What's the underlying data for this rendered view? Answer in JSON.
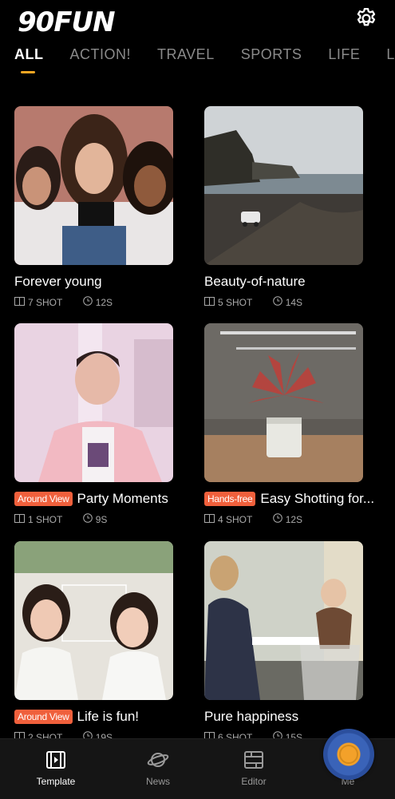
{
  "header": {
    "logo_text": "90FUN",
    "settings_icon": "gear-icon"
  },
  "tabs": [
    {
      "label": "ALL",
      "active": true
    },
    {
      "label": "ACTION!",
      "active": false
    },
    {
      "label": "TRAVEL",
      "active": false
    },
    {
      "label": "SPORTS",
      "active": false
    },
    {
      "label": "LIFE",
      "active": false
    },
    {
      "label": "L",
      "active": false
    }
  ],
  "cards": [
    {
      "title": "Forever young",
      "badge": "",
      "shots": "7 SHOT",
      "duration": "12S"
    },
    {
      "title": "Beauty-of-nature",
      "badge": "",
      "shots": "5 SHOT",
      "duration": "14S"
    },
    {
      "title": "Party Moments",
      "badge": "Around View",
      "shots": "1 SHOT",
      "duration": "9S"
    },
    {
      "title": "Easy Shotting for...",
      "badge": "Hands-free",
      "shots": "4 SHOT",
      "duration": "12S"
    },
    {
      "title": "Life is fun!",
      "badge": "Around View",
      "shots": "2 SHOT",
      "duration": "19S"
    },
    {
      "title": "Pure happiness",
      "badge": "",
      "shots": "6 SHOT",
      "duration": "15S"
    }
  ],
  "nav": [
    {
      "label": "Template",
      "icon": "film-icon",
      "active": true
    },
    {
      "label": "News",
      "icon": "planet-icon",
      "active": false
    },
    {
      "label": "Editor",
      "icon": "editor-icon",
      "active": false
    },
    {
      "label": "Me",
      "icon": "profile-icon",
      "active": false
    }
  ],
  "colors": {
    "accent": "#f5a623",
    "badge": "#f0603c",
    "background": "#000000"
  }
}
